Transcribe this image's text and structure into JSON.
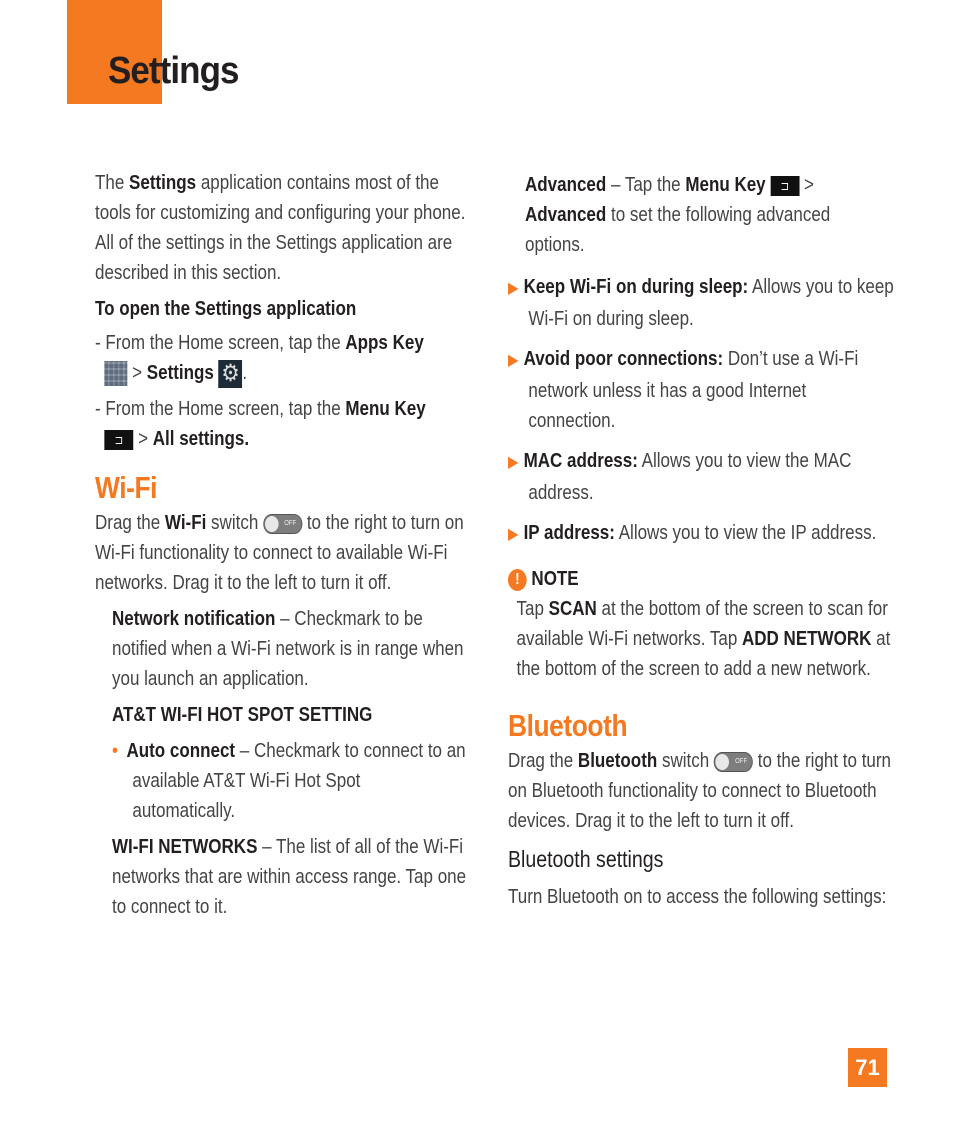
{
  "header": {
    "title": "Settings",
    "accent_color": "#f47920"
  },
  "intro": {
    "p1_a": "The ",
    "p1_b": "Settings",
    "p1_c": " application contains most of the tools for customizing and configuring your phone. All of the settings in the Settings application are described in this section.",
    "open_heading": "To open the Settings application",
    "step1_a": "- From the Home screen, tap the ",
    "step1_b": "Apps Key",
    "step1_c": " > ",
    "step1_d": "Settings",
    "step1_e": ".",
    "step2_a": "- From the Home screen, tap the ",
    "step2_b": "Menu Key",
    "step2_c": " > ",
    "step2_d": "All settings."
  },
  "wifi": {
    "heading": "Wi-Fi",
    "drag_a": "Drag the ",
    "drag_b": "Wi-Fi",
    "drag_c": " switch ",
    "drag_d": " to the right to turn on Wi-Fi functionality to connect to available Wi-Fi networks. Drag it to the left to turn it off.",
    "switch_label": "OFF",
    "nn_a": "Network notification",
    "nn_b": " – Checkmark to be notified when a Wi-Fi network is in range when you launch an application.",
    "hotspot_heading": "AT&T WI-FI HOT SPOT SETTING",
    "auto_a": "Auto connect",
    "auto_b": " – Checkmark to connect to an available AT&T Wi-Fi Hot Spot automatically.",
    "networks_a": "WI-FI NETWORKS",
    "networks_b": " – The list of all of the Wi-Fi networks that are within access range. Tap one to connect to it."
  },
  "advanced": {
    "a": "Advanced",
    "b": " – Tap the ",
    "c": "Menu Key",
    "d": " > ",
    "e": "Advanced",
    "f": " to set the following advanced options.",
    "items": [
      {
        "title": "Keep Wi-Fi on during sleep:",
        "text": " Allows you to keep Wi-Fi on during sleep."
      },
      {
        "title": "Avoid poor connections:",
        "text": " Don’t use a Wi-Fi network unless it has a good Internet connection."
      },
      {
        "title": "MAC address:",
        "text": " Allows you to view the MAC address."
      },
      {
        "title": "IP address:",
        "text": " Allows you to view the IP address."
      }
    ]
  },
  "note": {
    "heading": "NOTE",
    "a": "Tap ",
    "b": "SCAN",
    "c": " at the bottom of the screen to scan for available Wi-Fi networks. Tap ",
    "d": "ADD NETWORK",
    "e": " at the bottom of the screen to add a new network."
  },
  "bluetooth": {
    "heading": "Bluetooth",
    "drag_a": "Drag the ",
    "drag_b": "Bluetooth",
    "drag_c": " switch ",
    "drag_d": " to the right to turn on Bluetooth functionality to connect to Bluetooth devices. Drag it to the left to turn it off.",
    "switch_label": "OFF",
    "settings_heading": "Bluetooth settings",
    "settings_text": "Turn Bluetooth on to access the following settings:"
  },
  "footer": {
    "page_number": "71"
  }
}
